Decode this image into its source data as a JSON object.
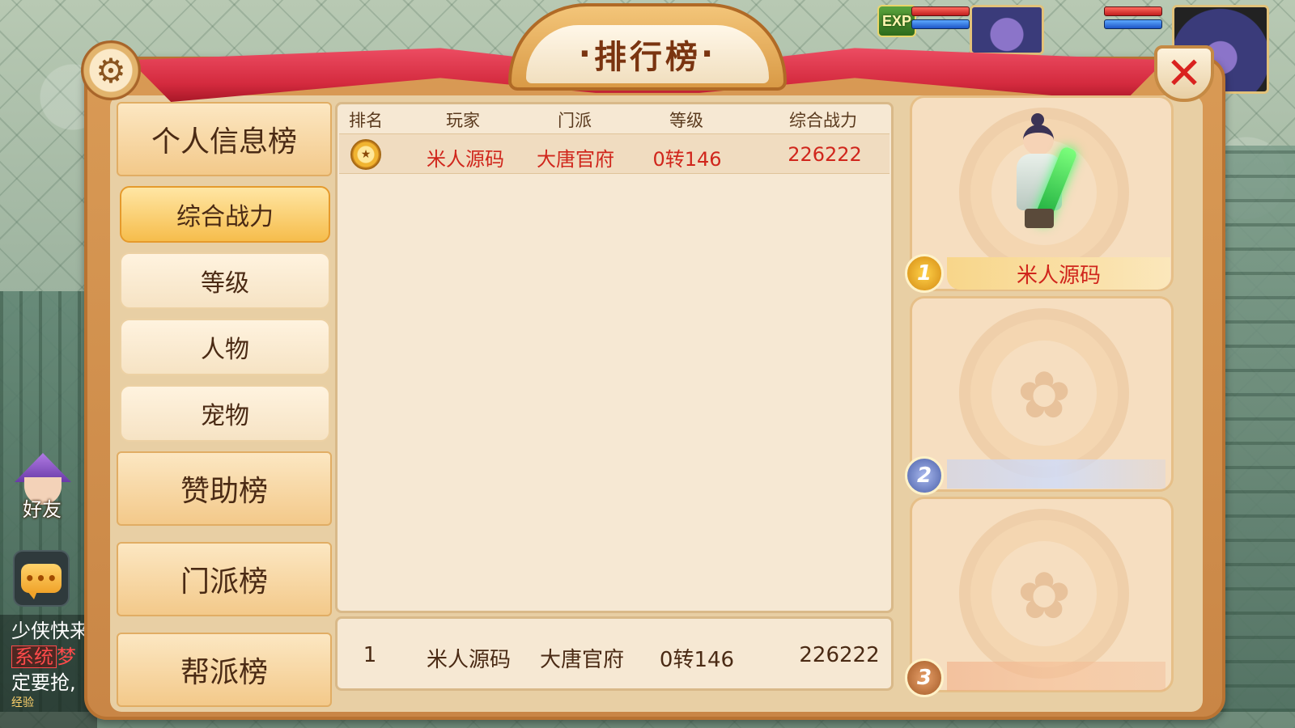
{
  "window": {
    "title": "排行榜"
  },
  "hud": {
    "exp_label": "EXP",
    "friends_label": "好友",
    "chat_lines": [
      {
        "text": "少侠快来"
      },
      {
        "tag": "系统",
        "text": "梦"
      },
      {
        "text": "定要抢,"
      }
    ],
    "exp_row_label": "经验"
  },
  "menu": {
    "personal_header": "个人信息榜",
    "personal_items": [
      "综合战力",
      "等级",
      "人物",
      "宠物"
    ],
    "active_index": 0,
    "sponsor_header": "赞助榜",
    "sect_header": "门派榜",
    "guild_header": "帮派榜"
  },
  "table": {
    "columns": [
      "排名",
      "玩家",
      "门派",
      "等级",
      "综合战力"
    ],
    "rows": [
      {
        "rank": 1,
        "player": "米人源码",
        "sect": "大唐官府",
        "level": "0转146",
        "power": "226222"
      }
    ]
  },
  "self_row": {
    "rank": "1",
    "player": "米人源码",
    "sect": "大唐官府",
    "level": "0转146",
    "power": "226222"
  },
  "top3": [
    {
      "rank": "1",
      "name": "米人源码"
    },
    {
      "rank": "2",
      "name": ""
    },
    {
      "rank": "3",
      "name": ""
    }
  ],
  "colors": {
    "accent_red": "#d0261c",
    "active_tab": "#f6bd4c",
    "title_brown": "#7a3410"
  },
  "icons": {
    "settings": "gear-icon",
    "close": "close-icon",
    "chat": "chat-icon",
    "rank_medal": "gold-medal-icon"
  }
}
